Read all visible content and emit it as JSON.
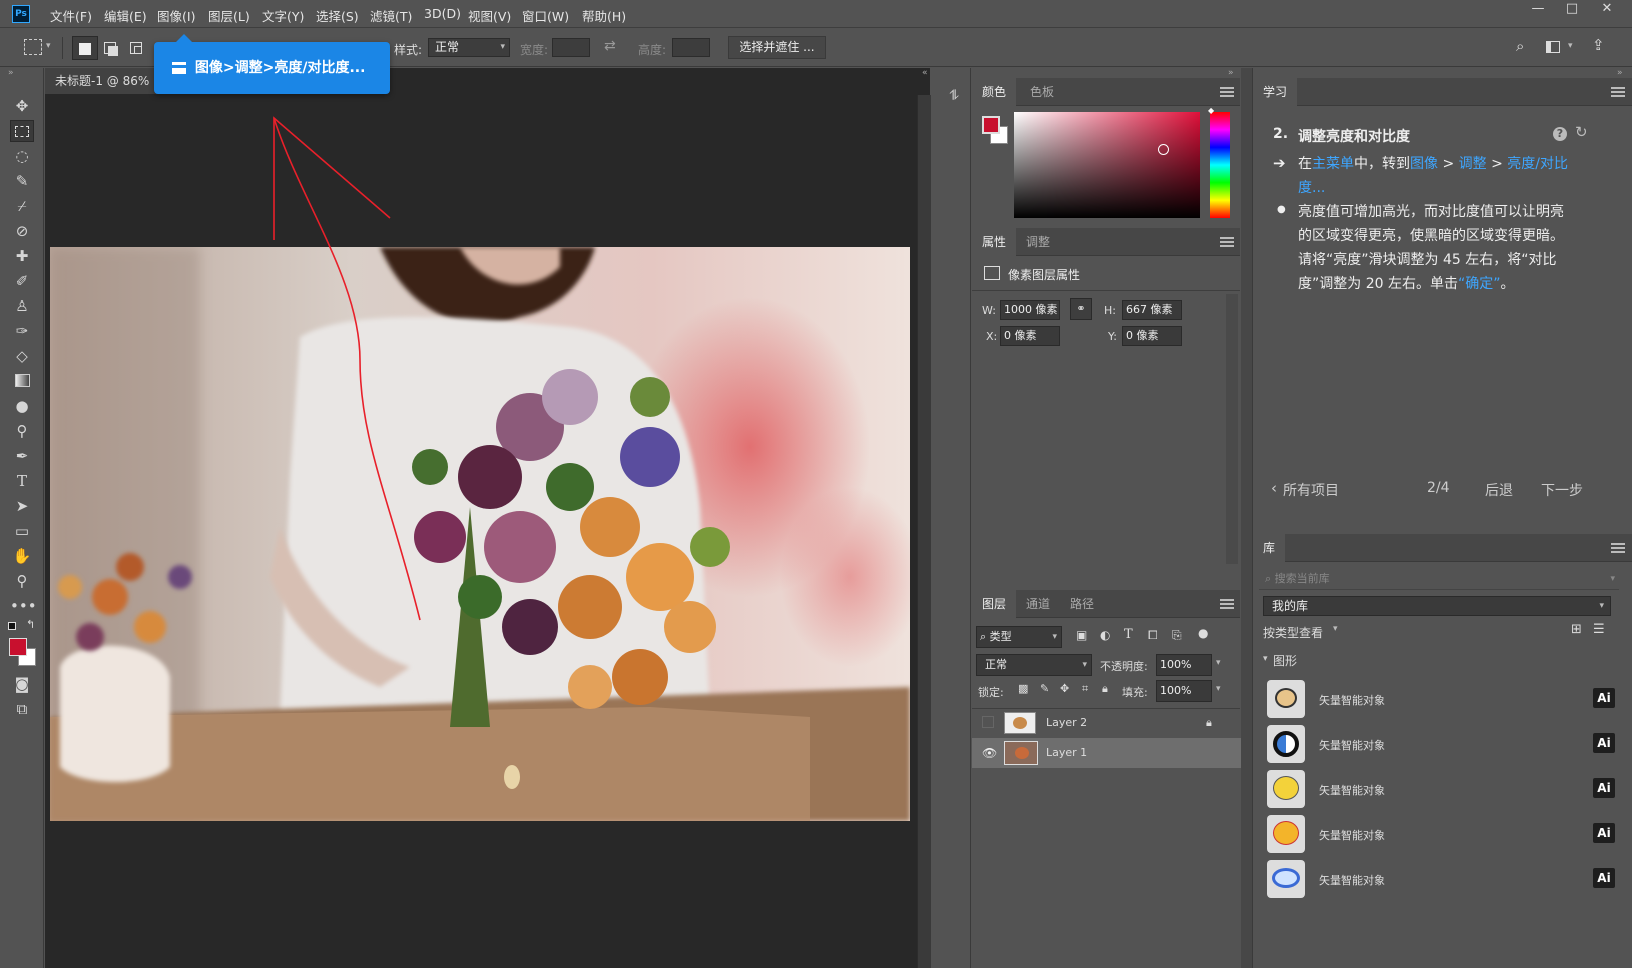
{
  "menubar": {
    "logo": "Ps",
    "items": [
      "文件(F)",
      "编辑(E)",
      "图像(I)",
      "图层(L)",
      "文字(Y)",
      "选择(S)",
      "滤镜(T)",
      "3D(D)",
      "视图(V)",
      "窗口(W)",
      "帮助(H)"
    ],
    "win_min": "—",
    "win_max": "□",
    "win_close": "✕"
  },
  "options": {
    "style_label": "样式:",
    "style_value": "正常",
    "width_label": "宽度:",
    "height_label": "高度:",
    "select_mask": "选择并遮住 ..."
  },
  "tooltip": {
    "text": "图像>调整>亮度/对比度..."
  },
  "document": {
    "tab_title": "未标题-1 @ 86% ("
  },
  "color_panel": {
    "tabs": [
      "颜色",
      "色板"
    ],
    "fg_color": "#c8102e",
    "bg_color": "#ffffff"
  },
  "properties": {
    "tabs": [
      "属性",
      "调整"
    ],
    "title": "像素图层属性",
    "w_label": "W:",
    "w_value": "1000 像素",
    "h_label": "H:",
    "h_value": "667 像素",
    "x_label": "X:",
    "x_value": "0 像素",
    "y_label": "Y:",
    "y_value": "0 像素"
  },
  "layers_panel": {
    "tabs": [
      "图层",
      "通道",
      "路径"
    ],
    "filter_type": "类型",
    "blend_mode": "正常",
    "opacity_label": "不透明度:",
    "opacity_value": "100%",
    "lock_label": "锁定:",
    "fill_label": "填充:",
    "fill_value": "100%",
    "layers": [
      {
        "name": "Layer 2",
        "visible": false,
        "locked": true
      },
      {
        "name": "Layer 1",
        "visible": true,
        "selected": true
      }
    ]
  },
  "learn_panel": {
    "tab": "学习",
    "step_num": "2.",
    "step_title": "调整亮度和对比度",
    "instr_1": "在",
    "instr_link1": "主菜单",
    "instr_2": "中，转到",
    "instr_link2": "图像",
    "instr_gt1": " > ",
    "instr_link3": "调整",
    "instr_gt2": " > ",
    "instr_link4a": "亮度/对比",
    "instr_link4b": "度...",
    "desc_1": "亮度值可增加高光，而对比度值可以让明亮",
    "desc_2": "的区域变得更亮，使黑暗的区域变得更暗。",
    "desc_3": "请将“亮度”滑块调整为 45 左右，将“对比",
    "desc_4a": "度”调整为 20 左右。单击",
    "desc_link": "“确定”",
    "desc_4b": "。",
    "back_all": "所有项目",
    "progress": "2/4",
    "back": "后退",
    "next": "下一步"
  },
  "library_panel": {
    "tab": "库",
    "search_placeholder": "搜索当前库",
    "library_name": "我的库",
    "view_by": "按类型查看",
    "section": "图形",
    "items": [
      {
        "label": "矢量智能对象",
        "badge": "Ai"
      },
      {
        "label": "矢量智能对象",
        "badge": "Ai"
      },
      {
        "label": "矢量智能对象",
        "badge": "Ai"
      },
      {
        "label": "矢量智能对象",
        "badge": "Ai"
      },
      {
        "label": "矢量智能对象",
        "badge": "Ai"
      }
    ]
  }
}
